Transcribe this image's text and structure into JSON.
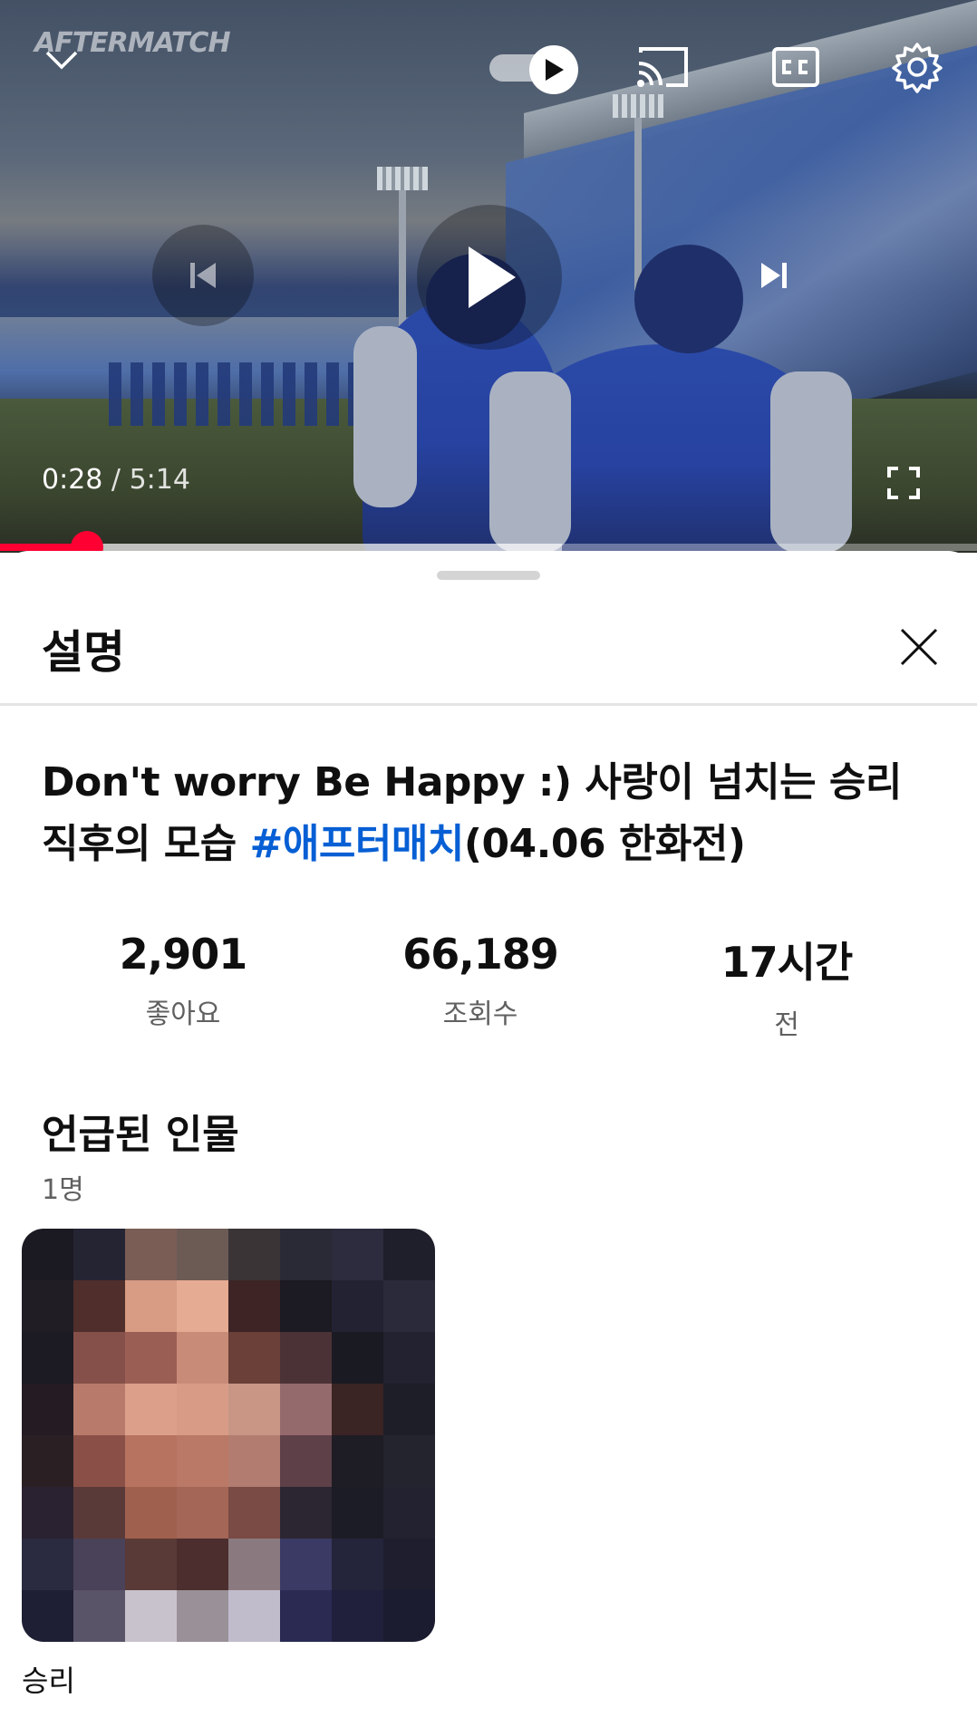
{
  "player": {
    "watermark": "AFTERMATCH",
    "current_time": "0:28",
    "separator": " / ",
    "duration": "5:14",
    "progress_fraction": 0.089,
    "buffer_fraction": 0.575,
    "icons": {
      "collapse": "chevron-down-icon",
      "autoplay": "autoplay-toggle-icon",
      "cast": "cast-icon",
      "captions": "captions-icon",
      "settings": "gear-icon",
      "previous": "previous-icon",
      "play": "play-icon",
      "next": "next-icon",
      "fullscreen": "fullscreen-icon"
    },
    "colors": {
      "progress": "#ff0033"
    }
  },
  "sheet": {
    "title": "설명",
    "close_icon": "close-icon",
    "video_title_part1": "Don't worry Be Happy :) 사랑이 넘치는 승리 직후의 모습 ",
    "video_title_hashtag": "#애프터매치",
    "video_title_part2": "(04.06 한화전)",
    "stats": [
      {
        "value": "2,901",
        "label": "좋아요"
      },
      {
        "value": "66,189",
        "label": "조회수"
      },
      {
        "value": "17시간",
        "label": "전"
      }
    ],
    "mentioned_section": {
      "title": "언급된 인물",
      "count": "1명",
      "people": [
        {
          "name": "승리"
        }
      ]
    },
    "colors": {
      "hashtag": "#065fd4",
      "secondary_text": "#606060"
    }
  }
}
